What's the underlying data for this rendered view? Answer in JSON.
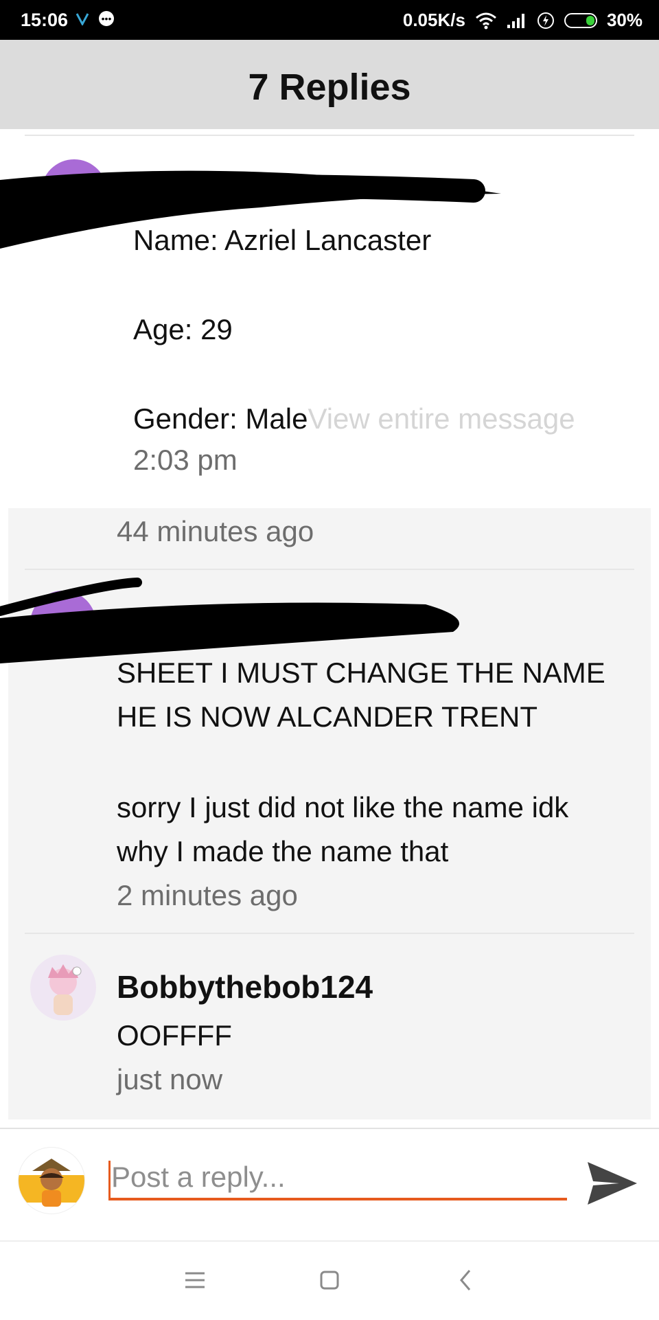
{
  "status_bar": {
    "time": "15:06",
    "network_speed": "0.05K/s",
    "battery": "30%"
  },
  "header": {
    "title": "7 Replies"
  },
  "messages": [
    {
      "lines": [
        "Name: Azriel Lancaster",
        "Age: 29"
      ],
      "last_line": "Gender: Male",
      "view_more": "View entire message",
      "time": "2:03 pm",
      "ago": "44 minutes ago"
    },
    {
      "lines": [
        "SHEET I MUST CHANGE THE NAME",
        "HE IS NOW ALCANDER TRENT",
        "sorry I just did not like the name idk",
        "why I made the name that"
      ],
      "ago": "2 minutes ago"
    },
    {
      "username": "Bobbythebob124",
      "text": "OOFFFF",
      "ago": "just now"
    }
  ],
  "reply": {
    "placeholder": "Post a reply..."
  },
  "icons": {
    "status": [
      "v-icon",
      "chat-dot-icon",
      "wifi-icon",
      "signal-icon",
      "charging-icon",
      "battery-icon"
    ],
    "nav": [
      "menu-icon",
      "home-square-icon",
      "back-chevron-icon"
    ],
    "send": "send-icon"
  },
  "colors": {
    "accent": "#e65a1e",
    "battery_fill": "#3ad13a",
    "avatar_purple": "#a96bd6"
  }
}
